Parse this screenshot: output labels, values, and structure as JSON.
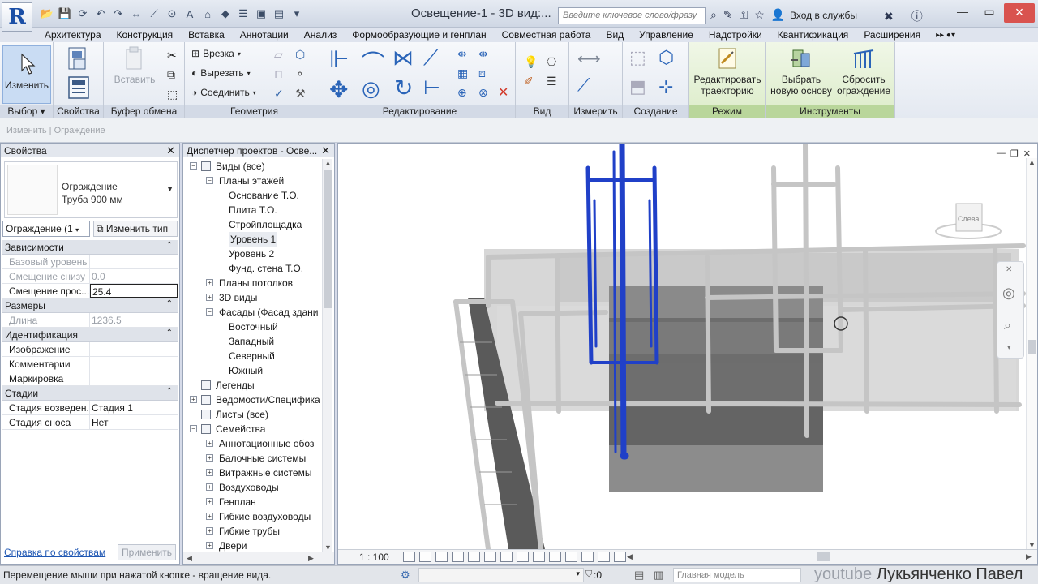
{
  "app": {
    "logo_letter": "R",
    "window_title": "Освещение-1 - 3D вид:...",
    "search_placeholder": "Введите ключевое слово/фразу",
    "signin_label": "Вход в службы"
  },
  "tabs": [
    "Архитектура",
    "Конструкция",
    "Вставка",
    "Аннотации",
    "Анализ",
    "Формообразующие и генплан",
    "Совместная работа",
    "Вид",
    "Управление",
    "Надстройки",
    "Квантификация",
    "Расширения"
  ],
  "ribbon": {
    "select": {
      "modify_label": "Изменить",
      "title": "Выбор"
    },
    "properties": {
      "title": "Свойства"
    },
    "clipboard": {
      "paste_label": "Вставить",
      "title": "Буфер обмена"
    },
    "geometry": {
      "cope_label": "Врезка",
      "cut_label": "Вырезать",
      "join_label": "Соединить",
      "title": "Геометрия"
    },
    "modify": {
      "title": "Редактирование"
    },
    "view": {
      "title": "Вид"
    },
    "measure": {
      "title": "Измерить"
    },
    "create": {
      "title": "Создание"
    },
    "mode": {
      "edit_path_label": "Редактировать траекторию",
      "title": "Режим"
    },
    "tools": {
      "pick_host_label": "Выбрать новую основу",
      "reset_railing_label": "Сбросить ограждение",
      "title": "Инструменты"
    }
  },
  "context": {
    "text": "Изменить | Ограждение"
  },
  "properties": {
    "title": "Свойства",
    "type_family": "Ограждение",
    "type_name": "Труба 900 мм",
    "instance_filter": "Ограждение (1",
    "edit_type_label": "Изменить тип",
    "sections": [
      {
        "name": "Зависимости",
        "rows": [
          {
            "key": "Базовый уровень",
            "value": "",
            "disabled": true
          },
          {
            "key": "Смещение снизу",
            "value": "0.0",
            "disabled": true
          },
          {
            "key": "Смещение прос...",
            "value": "25.4",
            "editing": true
          }
        ]
      },
      {
        "name": "Размеры",
        "rows": [
          {
            "key": "Длина",
            "value": "1236.5",
            "disabled": true
          }
        ]
      },
      {
        "name": "Идентификация",
        "rows": [
          {
            "key": "Изображение",
            "value": ""
          },
          {
            "key": "Комментарии",
            "value": ""
          },
          {
            "key": "Маркировка",
            "value": ""
          }
        ]
      },
      {
        "name": "Стадии",
        "rows": [
          {
            "key": "Стадия возведен...",
            "value": "Стадия 1"
          },
          {
            "key": "Стадия сноса",
            "value": "Нет"
          }
        ]
      }
    ],
    "help_link": "Справка по свойствам",
    "apply_label": "Применить"
  },
  "browser": {
    "title": "Диспетчер проектов - Осве...",
    "nodes": [
      {
        "label": "Виды (все)",
        "level": 0,
        "exp": "−",
        "icon": true
      },
      {
        "label": "Планы этажей",
        "level": 1,
        "exp": "−"
      },
      {
        "label": "Основание Т.О.",
        "level": 2
      },
      {
        "label": "Плита Т.О.",
        "level": 2
      },
      {
        "label": "Стройплощадка",
        "level": 2
      },
      {
        "label": "Уровень 1",
        "level": 2,
        "selected": true
      },
      {
        "label": "Уровень 2",
        "level": 2
      },
      {
        "label": "Фунд. стена Т.О.",
        "level": 2
      },
      {
        "label": "Планы потолков",
        "level": 1,
        "exp": "+"
      },
      {
        "label": "3D виды",
        "level": 1,
        "exp": "+"
      },
      {
        "label": "Фасады (Фасад здани",
        "level": 1,
        "exp": "−"
      },
      {
        "label": "Восточный",
        "level": 2
      },
      {
        "label": "Западный",
        "level": 2
      },
      {
        "label": "Северный",
        "level": 2
      },
      {
        "label": "Южный",
        "level": 2
      },
      {
        "label": "Легенды",
        "level": 0,
        "icon": true
      },
      {
        "label": "Ведомости/Специфика",
        "level": 0,
        "exp": "+",
        "icon": true
      },
      {
        "label": "Листы (все)",
        "level": 0,
        "icon": true
      },
      {
        "label": "Семейства",
        "level": 0,
        "exp": "−",
        "icon": true
      },
      {
        "label": "Аннотационные обоз",
        "level": 1,
        "exp": "+"
      },
      {
        "label": "Балочные системы",
        "level": 1,
        "exp": "+"
      },
      {
        "label": "Витражные системы",
        "level": 1,
        "exp": "+"
      },
      {
        "label": "Воздуховоды",
        "level": 1,
        "exp": "+"
      },
      {
        "label": "Генплан",
        "level": 1,
        "exp": "+"
      },
      {
        "label": "Гибкие воздуховоды",
        "level": 1,
        "exp": "+"
      },
      {
        "label": "Гибкие трубы",
        "level": 1,
        "exp": "+"
      },
      {
        "label": "Двери",
        "level": 1,
        "exp": "+"
      }
    ]
  },
  "view": {
    "viewcube_label": "Слева",
    "scale": "1 : 100"
  },
  "status": {
    "hint": "Перемещение мыши при нажатой кнопке - вращение вида.",
    "zero_value": ":0",
    "model": "Главная модель",
    "watermark_a": "youtube ",
    "watermark_b": "Лукьянченко Павел"
  },
  "colors": {
    "selected_railing": "#2040c8",
    "railing": "#c8c8c8",
    "stair": "#707070"
  }
}
